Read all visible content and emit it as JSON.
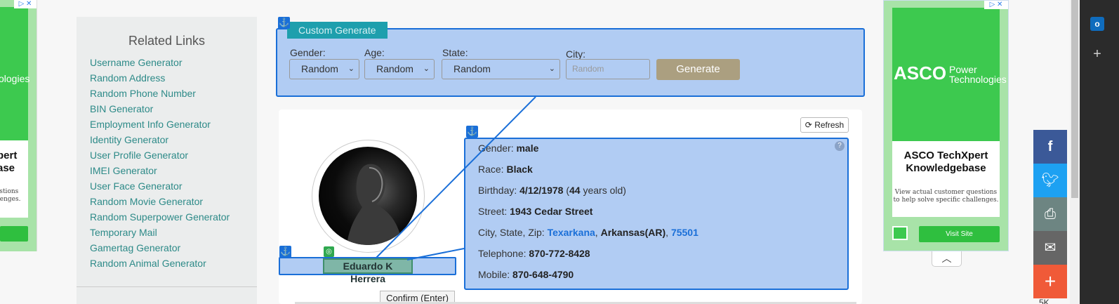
{
  "ad_left": {
    "line1": "ologies",
    "line2": "pert",
    "line3": "ase",
    "line4": "estions",
    "line5": "llenges.",
    "adchoices": "▷ ✕"
  },
  "sidebar": {
    "title": "Related Links",
    "links": [
      "Username Generator",
      "Random Address",
      "Random Phone Number",
      "BIN Generator",
      "Employment Info Generator",
      "Identity Generator",
      "User Profile Generator",
      "IMEI Generator",
      "User Face Generator",
      "Random Movie Generator",
      "Random Superpower Generator",
      "Temporary Mail",
      "Gamertag Generator",
      "Random Animal Generator"
    ]
  },
  "generate": {
    "tab_label": "Custom Generate",
    "gender_label": "Gender:",
    "gender_value": "Random",
    "age_label": "Age:",
    "age_value": "Random",
    "state_label": "State:",
    "state_value": "Random",
    "city_label": "City:",
    "city_placeholder": "Random",
    "button": "Generate"
  },
  "card": {
    "refresh": "Refresh",
    "name": "Eduardo K Herrera",
    "confirm": "Confirm (Enter)",
    "gender_label": "Gender:",
    "gender": "male",
    "race_label": "Race:",
    "race": "Black",
    "birthday_label": "Birthday:",
    "birthday": "4/12/1978",
    "age": "44",
    "age_suffix": "years old)",
    "street_label": "Street:",
    "street": "1943 Cedar Street",
    "csz_label": "City, State, Zip:",
    "city": "Texarkana",
    "state": "Arkansas(AR)",
    "zip": "75501",
    "telephone_label": "Telephone:",
    "telephone": "870-772-8428",
    "mobile_label": "Mobile:",
    "mobile": "870-648-4790"
  },
  "ad_right": {
    "brand": "ASCO",
    "brand_sub1": "Power",
    "brand_sub2": "Technologies",
    "headline": "ASCO TechXpert Knowledgebase",
    "sub": "View actual customer questions to help solve specific challenges.",
    "cta": "Visit Site",
    "adchoices": "▷ ✕"
  },
  "share": {
    "count": "5K"
  },
  "colors": {
    "facebook": "#3b5998",
    "twitter": "#1da1f2",
    "print": "#6d8582",
    "email": "#666666",
    "more": "#f05a38"
  }
}
